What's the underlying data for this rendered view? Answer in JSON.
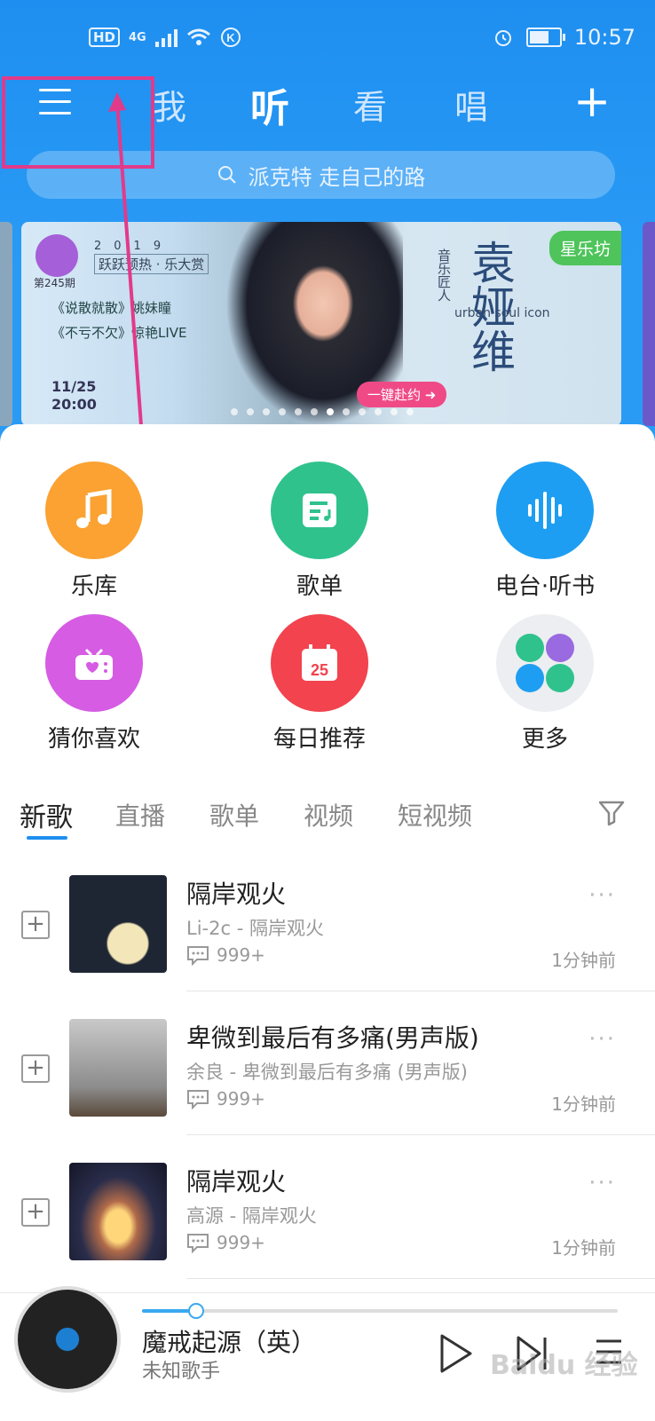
{
  "status_bar": {
    "hd": "HD",
    "network": "4G",
    "time": "10:57"
  },
  "nav": {
    "tabs": [
      {
        "label": "我",
        "active": false
      },
      {
        "label": "听",
        "active": true
      },
      {
        "label": "看",
        "active": false
      },
      {
        "label": "唱",
        "active": false
      }
    ],
    "plus": "+"
  },
  "search": {
    "placeholder": "派克特 走自己的路"
  },
  "banner": {
    "tag": "星乐坊",
    "year": "2019",
    "subtitle": "跃跃预热 · 乐大赏",
    "episode": "第245期",
    "line1": "《说散就散》姚妹瞳",
    "line2": "《不亏不欠》惊艳LIVE",
    "date": "11/25",
    "time": "20:00",
    "role": "音乐匠人",
    "english": "urban soul icon",
    "artist": "袁娅维",
    "cta": "一键赴约 ➜",
    "dot_count": 12,
    "active_dot": 6
  },
  "grid": [
    {
      "label": "乐库",
      "icon": "music-note-icon",
      "color": "#fba232"
    },
    {
      "label": "歌单",
      "icon": "playlist-icon",
      "color": "#2fc28d"
    },
    {
      "label": "电台·听书",
      "icon": "soundwave-icon",
      "color": "#1e9ef2"
    },
    {
      "label": "猜你喜欢",
      "icon": "radio-heart-icon",
      "color": "#d65ce3"
    },
    {
      "label": "每日推荐",
      "icon": "calendar-icon",
      "color": "#f2434e"
    },
    {
      "label": "更多",
      "icon": "more-apps-icon",
      "color": "#eceef1"
    }
  ],
  "calendar_day": "25",
  "content_tabs": [
    "新歌",
    "直播",
    "歌单",
    "视频",
    "短视频"
  ],
  "songs": [
    {
      "title": "隔岸观火",
      "artist": "Li-2c - 隔岸观火",
      "comments": "999+",
      "time": "1分钟前"
    },
    {
      "title": "卑微到最后有多痛(男声版)",
      "artist": "余良 - 卑微到最后有多痛 (男声版)",
      "comments": "999+",
      "time": "1分钟前"
    },
    {
      "title": "隔岸观火",
      "artist": "高源 - 隔岸观火",
      "comments": "999+",
      "time": "1分钟前"
    }
  ],
  "player": {
    "title": "魔戒起源（英）",
    "artist": "未知歌手",
    "progress": 0.11
  },
  "watermark": "Baidu 经验",
  "colors": {
    "primary": "#1e8ff0",
    "highlight": "#e23a8a"
  }
}
